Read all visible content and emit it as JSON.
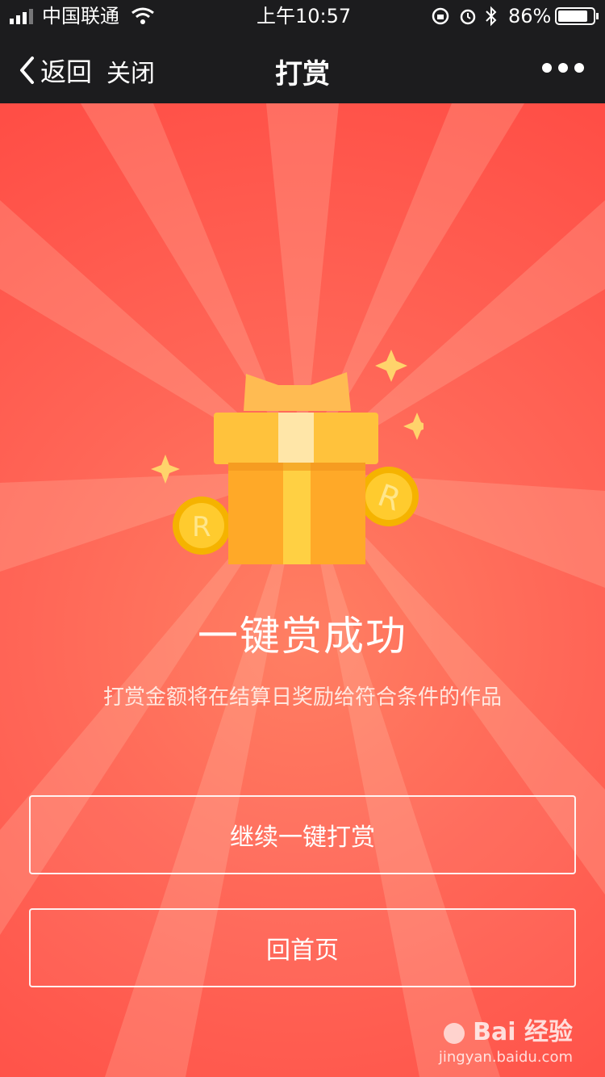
{
  "status_bar": {
    "carrier": "中国联通",
    "time": "上午10:57",
    "battery": "86%"
  },
  "nav": {
    "back_label": "返回",
    "close_label": "关闭",
    "title": "打赏"
  },
  "main": {
    "headline": "一键赏成功",
    "description": "打赏金额将在结算日奖励给符合条件的作品",
    "coin_letter": "R",
    "buttons": {
      "continue_label": "继续一键打赏",
      "home_label": "回首页"
    }
  },
  "watermark": {
    "brand": "Bai 经验",
    "site": "jingyan.baidu.com"
  },
  "colors": {
    "nav_bg": "#1c1c1e",
    "page_red": "#ff5a4f",
    "gift_orange": "#ffb122",
    "gift_lid": "#ffc33f"
  }
}
